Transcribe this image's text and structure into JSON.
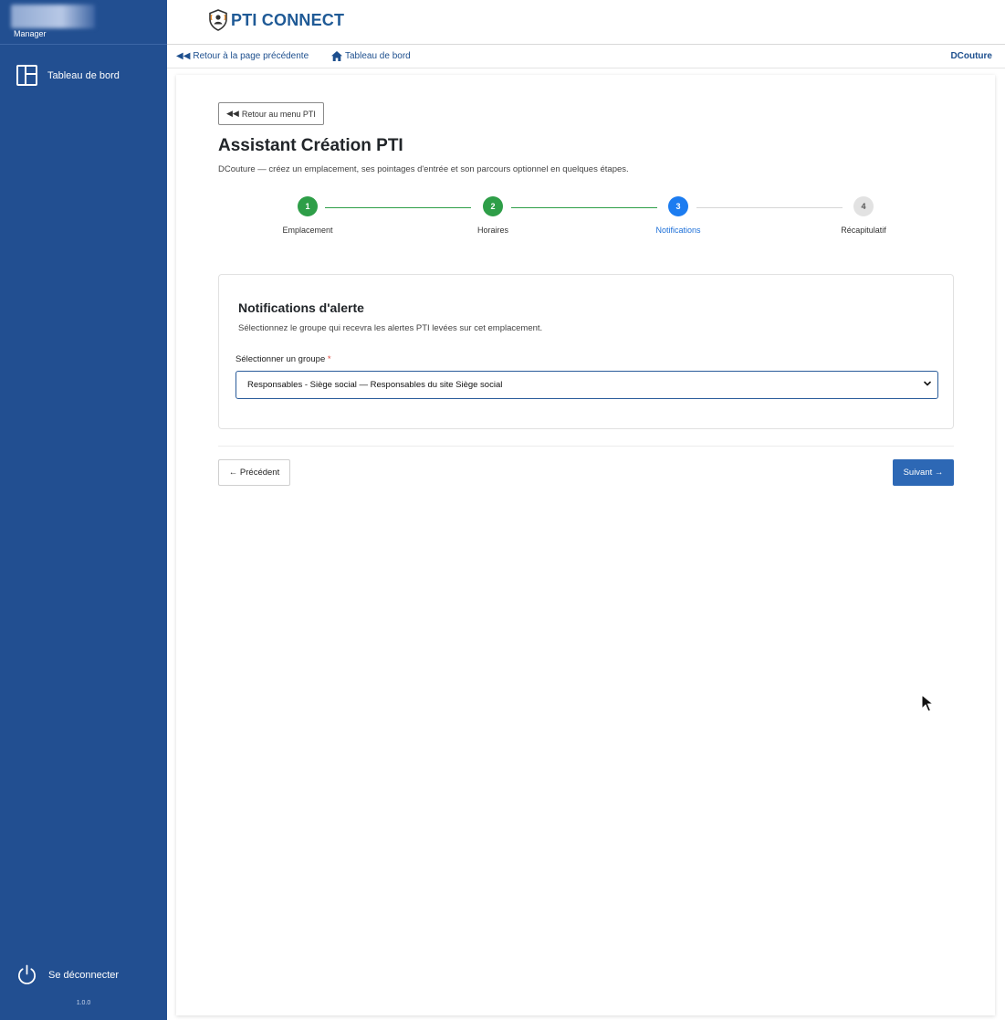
{
  "sidebar": {
    "role": "Manager",
    "nav": [
      {
        "label": "Tableau de bord",
        "icon": "dashboard-icon"
      }
    ],
    "logout_label": "Se déconnecter",
    "version": "1.0.0"
  },
  "header": {
    "logo_text": "PTI CONNECT",
    "back_link": "Retour à la page précédente",
    "home_link": "Tableau de bord",
    "user": "DCouture"
  },
  "page": {
    "back_menu_label": "Retour au menu PTI",
    "title": "Assistant Création PTI",
    "subtitle": "DCouture — créez un emplacement, ses pointages d'entrée et son parcours optionnel en quelques étapes."
  },
  "stepper": {
    "steps": [
      {
        "number": "1",
        "label": "Emplacement",
        "state": "done"
      },
      {
        "number": "2",
        "label": "Horaires",
        "state": "done"
      },
      {
        "number": "3",
        "label": "Notifications",
        "state": "active"
      },
      {
        "number": "4",
        "label": "Récapitulatif",
        "state": "todo"
      }
    ]
  },
  "notifications": {
    "title": "Notifications d'alerte",
    "description": "Sélectionnez le groupe qui recevra les alertes PTI levées sur cet emplacement.",
    "field_label": "Sélectionner un groupe",
    "required_mark": "*",
    "selected_value": "Responsables - Siège social — Responsables du site Siège social"
  },
  "actions": {
    "previous_label": "← Précédent",
    "next_label": "Suivant →"
  },
  "colors": {
    "sidebar": "#224f91",
    "brand": "#1f5a96",
    "step_done": "#2e9e48",
    "step_active": "#1c7cf0",
    "step_todo": "#e2e2e2",
    "primary_button": "#2d68b5"
  }
}
